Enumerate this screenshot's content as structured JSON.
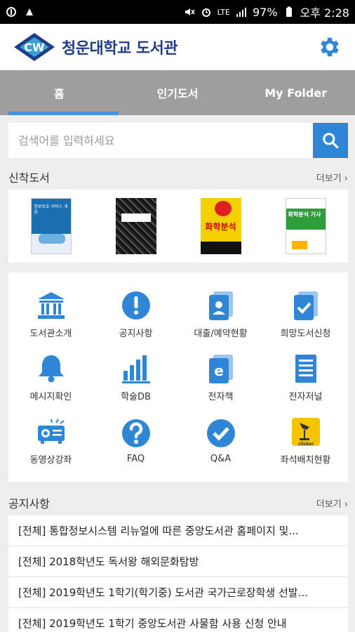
{
  "status_bar": {
    "battery": "97%",
    "time": "오후 2:28",
    "network": "LTE"
  },
  "app": {
    "logo_text": "CW",
    "title": "청운대학교 도서관"
  },
  "tabs": [
    {
      "label": "홈",
      "active": true
    },
    {
      "label": "인기도서",
      "active": false
    },
    {
      "label": "My Folder",
      "active": false
    }
  ],
  "search": {
    "placeholder": "검색어를 입력하세요"
  },
  "new_books": {
    "title": "신착도서",
    "more": "더보기 ›",
    "items": [
      {
        "cover_text": "정보보호 서비스 개론",
        "color": "#1a6fb0"
      },
      {
        "cover_text": "",
        "color": "#222222"
      },
      {
        "cover_text": "화학분석",
        "color": "#f5d000"
      },
      {
        "cover_text": "화학분석 기사",
        "color": "#2e9e3c"
      }
    ]
  },
  "menu": {
    "items": [
      {
        "label": "도서관소개",
        "icon": "library-icon"
      },
      {
        "label": "공지사항",
        "icon": "notice-icon"
      },
      {
        "label": "대출/예약현황",
        "icon": "loan-icon"
      },
      {
        "label": "희망도서신청",
        "icon": "request-icon"
      },
      {
        "label": "메시지확인",
        "icon": "bell-icon"
      },
      {
        "label": "학술DB",
        "icon": "chart-icon"
      },
      {
        "label": "전자책",
        "icon": "ebook-icon"
      },
      {
        "label": "전자저널",
        "icon": "journal-icon"
      },
      {
        "label": "동영상강좌",
        "icon": "projector-icon"
      },
      {
        "label": "FAQ",
        "icon": "faq-icon"
      },
      {
        "label": "Q&A",
        "icon": "qa-icon"
      },
      {
        "label": "좌석배치현황",
        "icon": "seat-icon"
      }
    ]
  },
  "notices": {
    "title": "공지사항",
    "more": "더보기 ›",
    "items": [
      "[전체] 통합정보시스템 리뉴얼에 따른 중앙도서관 홈페이지 및...",
      "[전체] 2018학년도 독서왕 해외문화탐방",
      "[전체] 2019학년도 1학기(학기중) 도서관 국가근로장학생 선발...",
      "[전체] 2019학년도 1학기 중앙도서관 사물함 사용 신청 안내"
    ]
  },
  "colors": {
    "primary": "#2f86d6",
    "tab_bg": "#9e9e9e",
    "brand": "#1f3c88"
  }
}
